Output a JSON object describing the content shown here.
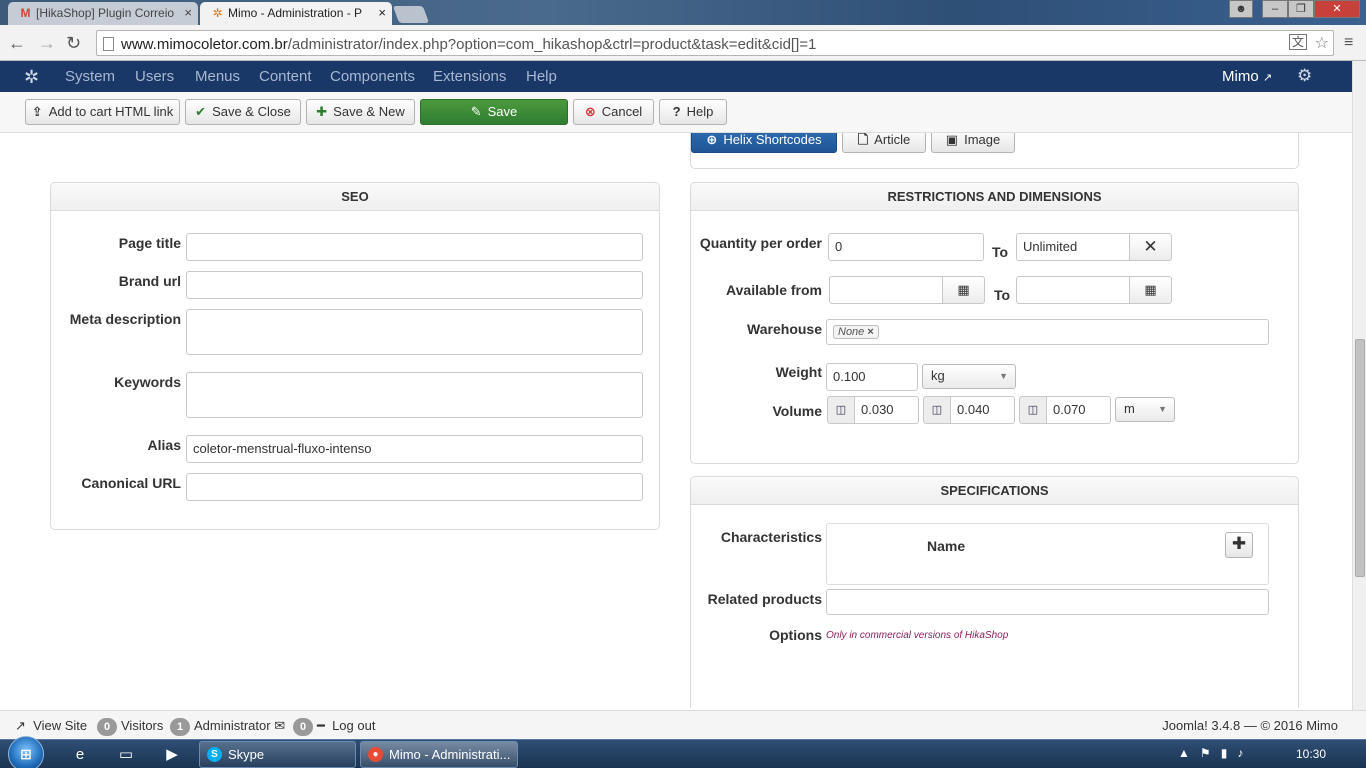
{
  "browser": {
    "tabs": [
      {
        "label": "[HikaShop] Plugin Correio",
        "icon": "gmail-icon"
      },
      {
        "label": "Mimo - Administration - P",
        "icon": "joomla-icon"
      }
    ],
    "url_host": "www.mimocoletor.com.br",
    "url_path": "/administrator/index.php?option=com_hikashop&ctrl=product&task=edit&cid[]=1"
  },
  "joomla_nav": {
    "items": [
      "System",
      "Users",
      "Menus",
      "Content",
      "Components",
      "Extensions",
      "Help"
    ],
    "user": "Mimo"
  },
  "toolbar": {
    "cart_link": "Add to cart HTML link",
    "save_close": "Save & Close",
    "save_new": "Save & New",
    "save": "Save",
    "cancel": "Cancel",
    "help": "Help"
  },
  "editor_buttons": {
    "helix": "Helix Shortcodes",
    "article": "Article",
    "image": "Image"
  },
  "seo": {
    "title": "SEO",
    "page_title_label": "Page title",
    "page_title_value": "",
    "brand_url_label": "Brand url",
    "brand_url_value": "",
    "meta_description_label": "Meta description",
    "keywords_label": "Keywords",
    "alias_label": "Alias",
    "alias_value": "coletor-menstrual-fluxo-intenso",
    "canonical_label": "Canonical URL",
    "canonical_value": ""
  },
  "restrictions": {
    "title": "RESTRICTIONS AND DIMENSIONS",
    "qty_label": "Quantity per order",
    "qty_from": "0",
    "to_label": "To",
    "qty_to": "Unlimited",
    "available_label": "Available from",
    "warehouse_label": "Warehouse",
    "warehouse_value": "None",
    "weight_label": "Weight",
    "weight_value": "0.100",
    "weight_unit": "kg",
    "volume_label": "Volume",
    "volume_values": [
      "0.030",
      "0.040",
      "0.070"
    ],
    "volume_unit": "m"
  },
  "specifications": {
    "title": "SPECIFICATIONS",
    "characteristics_label": "Characteristics",
    "name_header": "Name",
    "related_label": "Related products",
    "options_label": "Options",
    "options_note": "Only in commercial versions of HikaShop"
  },
  "statusbar": {
    "view_site": "View Site",
    "visitors_count": "0",
    "visitors": "Visitors",
    "admin_count": "1",
    "admin": "Administrator",
    "messages_count": "0",
    "logout": "Log out",
    "version": "Joomla! 3.4.8 — © 2016 Mimo"
  },
  "taskbar": {
    "tasks": [
      "Skype",
      "Mimo - Administrati..."
    ],
    "clock": "10:30"
  }
}
